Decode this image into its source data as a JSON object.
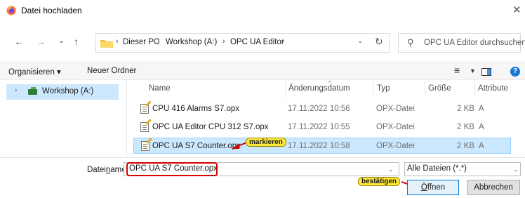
{
  "window": {
    "title": "Datei hochladen",
    "close_label": "✕"
  },
  "nav": {
    "back_label": "←",
    "forward_label": "→",
    "recent_label": "⌄",
    "up_label": "↑",
    "breadcrumbs": [
      "Dieser PC",
      "Workshop (A:)",
      "OPC UA Editor"
    ],
    "crumb_separator": "›",
    "refresh_label": "↻",
    "search_placeholder": "OPC UA Editor durchsuchen"
  },
  "toolbar": {
    "organize_label": "Organisieren ▾",
    "new_folder_label": "Neuer Ordner",
    "help_label": "?"
  },
  "tree": {
    "selected_item": "Workshop (A:)"
  },
  "columns": {
    "name": "Name",
    "modified": "Änderungsdatum",
    "type": "Typ",
    "size": "Größe",
    "attributes": "Attribute"
  },
  "files": [
    {
      "name": "CPU 416 Alarms S7.opx",
      "modified": "17.11.2022 10:56",
      "type": "OPX-Datei",
      "size": "2 KB",
      "attr": "A",
      "selected": false
    },
    {
      "name": "OPC UA Editor CPU 312 S7.opx",
      "modified": "17.11.2022 10:55",
      "type": "OPX-Datei",
      "size": "2 KB",
      "attr": "A",
      "selected": false
    },
    {
      "name": "OPC UA S7 Counter.opx",
      "modified": "17.11.2022 10:58",
      "type": "OPX-Datei",
      "size": "2 KB",
      "attr": "A",
      "selected": true
    }
  ],
  "annotations": {
    "select_label": "markieren",
    "confirm_label": "bestätigen",
    "arrow_color": "#d50000",
    "label_color": "#ffeb3b"
  },
  "footer": {
    "filename_label_pre": "Datei",
    "filename_label_underlined": "n",
    "filename_label_post": "ame:",
    "filename_value": "OPC UA S7 Counter.opx",
    "filetype_value": "Alle Dateien (*.*)",
    "open_underlined": "Ö",
    "open_rest": "ffnen",
    "cancel_label": "Abbrechen"
  },
  "colors": {
    "selection": "#cce8ff",
    "accent": "#0078d7",
    "app_icon": "#ff7139"
  }
}
